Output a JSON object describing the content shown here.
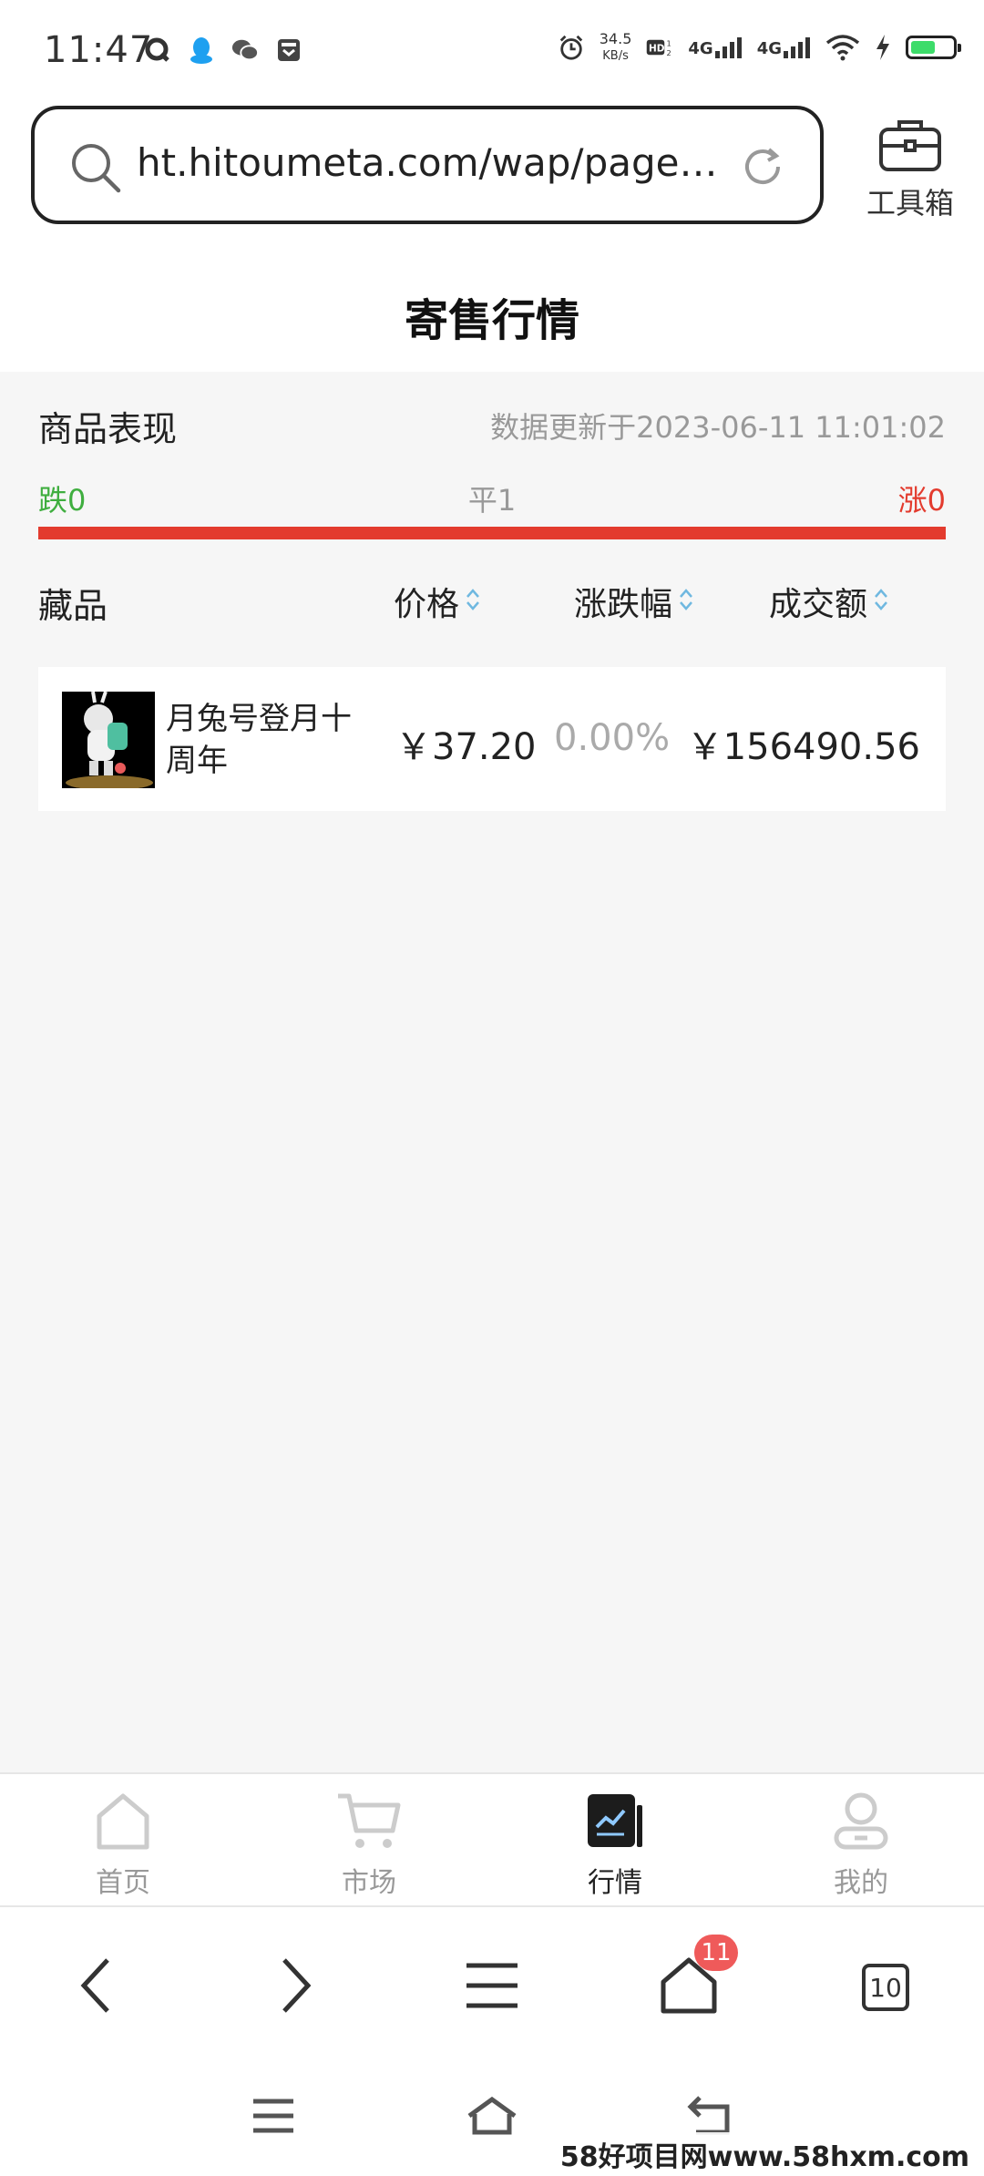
{
  "status_bar": {
    "time": "11:47",
    "net_speed_value": "34.5",
    "net_speed_unit": "KB/s",
    "signal1": "4G",
    "signal2": "4G",
    "battery_color": "#3ddc6a"
  },
  "address_bar": {
    "url": "ht.hitoumeta.com/wap/page…",
    "toolbox_label": "工具箱"
  },
  "page": {
    "title": "寄售行情"
  },
  "summary": {
    "title": "商品表现",
    "updated": "数据更新于2023-06-11 11:01:02",
    "down": "跌0",
    "flat": "平1",
    "up": "涨0",
    "down_color": "#3fae3f",
    "up_color": "#e33b2e"
  },
  "table": {
    "headers": {
      "name": "藏品",
      "price": "价格",
      "change": "涨跌幅",
      "amount": "成交额"
    },
    "rows": [
      {
        "name": "月兔号登月十周年",
        "price": "￥37.20",
        "change": "0.00%",
        "amount": "￥156490.56"
      }
    ]
  },
  "tabbar": {
    "items": [
      {
        "label": "首页",
        "icon": "home-icon"
      },
      {
        "label": "市场",
        "icon": "cart-icon"
      },
      {
        "label": "行情",
        "icon": "chart-icon",
        "active": true
      },
      {
        "label": "我的",
        "icon": "user-icon"
      }
    ]
  },
  "browser_nav": {
    "home_badge": "11",
    "tabs_count": "10"
  },
  "watermark": "58好项目网www.58hxm.com"
}
